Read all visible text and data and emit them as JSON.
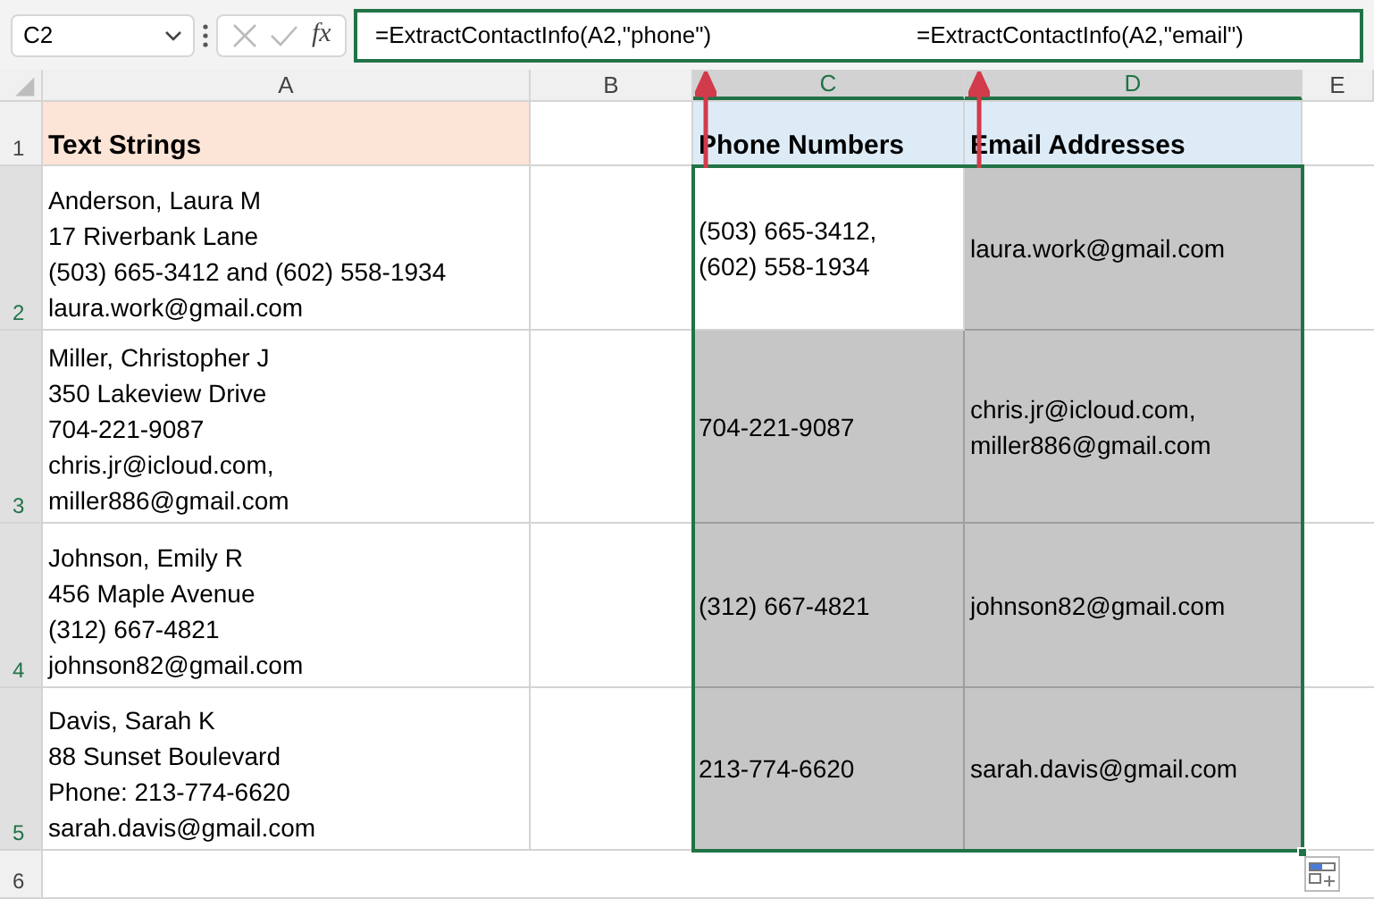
{
  "name_box": {
    "value": "C2"
  },
  "formula_bar": {
    "function_label": "fx",
    "segments": [
      "=ExtractContactInfo(A2,\"phone\")",
      "=ExtractContactInfo(A2,\"email\")"
    ]
  },
  "columns": [
    {
      "label": "A",
      "selected": false
    },
    {
      "label": "B",
      "selected": false
    },
    {
      "label": "C",
      "selected": true
    },
    {
      "label": "D",
      "selected": true
    },
    {
      "label": "E",
      "selected": false
    }
  ],
  "rows": [
    {
      "number": "1",
      "selected": false,
      "cells": [
        {
          "lines": [
            "Text Strings"
          ],
          "kind": "header",
          "color": "#fce4d6"
        },
        {
          "kind": "empty"
        },
        {
          "lines": [
            "Phone Numbers"
          ],
          "kind": "header",
          "color": "#ddebf7"
        },
        {
          "lines": [
            "Email Addresses"
          ],
          "kind": "header",
          "color": "#ddebf7"
        }
      ]
    },
    {
      "number": "2",
      "selected": true,
      "cells": [
        {
          "lines": [
            "Anderson, Laura M",
            "17 Riverbank Lane",
            "(503) 665-3412 and (602) 558-1934",
            "laura.work@gmail.com"
          ],
          "kind": "source"
        },
        {
          "kind": "empty"
        },
        {
          "lines": [
            "(503) 665-3412,",
            "(602) 558-1934"
          ],
          "kind": "result",
          "selected": false
        },
        {
          "lines": [
            "laura.work@gmail.com"
          ],
          "kind": "result",
          "selected": true
        }
      ]
    },
    {
      "number": "3",
      "selected": true,
      "cells": [
        {
          "lines": [
            "Miller, Christopher J",
            "350 Lakeview Drive",
            "704-221-9087",
            "chris.jr@icloud.com,",
            "miller886@gmail.com"
          ],
          "kind": "source"
        },
        {
          "kind": "empty"
        },
        {
          "lines": [
            "704-221-9087"
          ],
          "kind": "result",
          "selected": true
        },
        {
          "lines": [
            "chris.jr@icloud.com,",
            "miller886@gmail.com"
          ],
          "kind": "result",
          "selected": true
        }
      ]
    },
    {
      "number": "4",
      "selected": true,
      "cells": [
        {
          "lines": [
            "Johnson, Emily R",
            "456 Maple Avenue",
            "(312) 667-4821",
            "johnson82@gmail.com"
          ],
          "kind": "source"
        },
        {
          "kind": "empty"
        },
        {
          "lines": [
            "(312) 667-4821"
          ],
          "kind": "result",
          "selected": true
        },
        {
          "lines": [
            "johnson82@gmail.com"
          ],
          "kind": "result",
          "selected": true
        }
      ]
    },
    {
      "number": "5",
      "selected": true,
      "cells": [
        {
          "lines": [
            "Davis, Sarah K",
            "88 Sunset Boulevard",
            "Phone: 213-774-6620",
            "sarah.davis@gmail.com"
          ],
          "kind": "source"
        },
        {
          "kind": "empty"
        },
        {
          "lines": [
            "213-774-6620"
          ],
          "kind": "result",
          "selected": true
        },
        {
          "lines": [
            "sarah.davis@gmail.com"
          ],
          "kind": "result",
          "selected": true
        }
      ]
    },
    {
      "number": "6",
      "selected": false,
      "cells": []
    }
  ]
}
